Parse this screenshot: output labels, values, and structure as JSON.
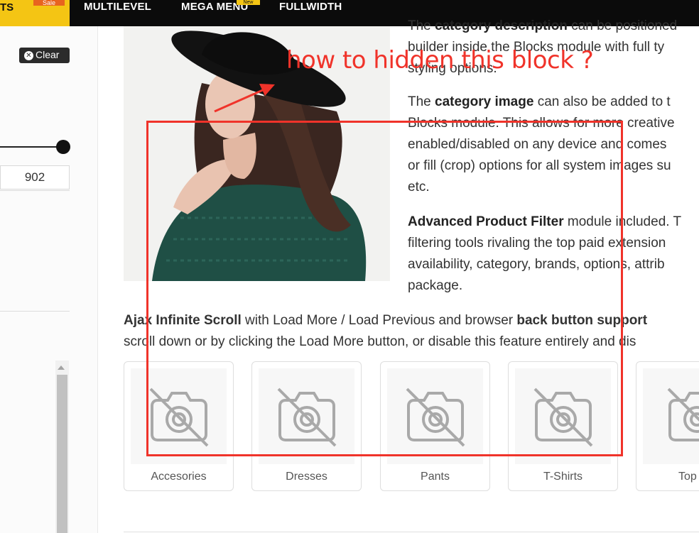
{
  "nav": {
    "first_item": "TS",
    "sale_badge": "Sale",
    "items": [
      "MULTILEVEL",
      "MEGA MENU",
      "FULLWIDTH"
    ],
    "new_badge": "New"
  },
  "sidebar": {
    "clear_label": "Clear",
    "price_value": "902"
  },
  "content": {
    "p1": {
      "line1_pre": "The ",
      "line1_bold": "category description",
      "line1_post": " can be positioned",
      "line2": "builder inside the Blocks module with full ty",
      "line3": "styling options."
    },
    "p2": {
      "line1_pre": "The ",
      "line1_bold": "category image",
      "line1_post": " can also be added to t",
      "line2": "Blocks module. This allows for more creative",
      "line3": "enabled/disabled on any device and comes",
      "line4": "or fill (crop) options for all system images su",
      "line5": "etc."
    },
    "p3": {
      "line1_bold": "Advanced Product Filter",
      "line1_post": " module included. T",
      "line2": "filtering tools rivaling the top paid extension",
      "line3": "availability, category, brands, options, attrib",
      "line4": "package."
    },
    "p4": {
      "line1_bold1": "Ajax Infinite Scroll",
      "line1_mid": " with Load More / Load Previous and browser ",
      "line1_bold2": "back button support",
      "line2": "scroll down or by clicking the Load More button, or disable this feature entirely and dis"
    }
  },
  "categories": [
    "Accesories",
    "Dresses",
    "Pants",
    "T-Shirts",
    "Top"
  ],
  "annotation": {
    "text": "how to hidden this block ?",
    "color": "#f0332a"
  },
  "colors": {
    "nav_bg": "#0b0b0b",
    "nav_accent": "#f4c514",
    "sale": "#e8641f"
  }
}
